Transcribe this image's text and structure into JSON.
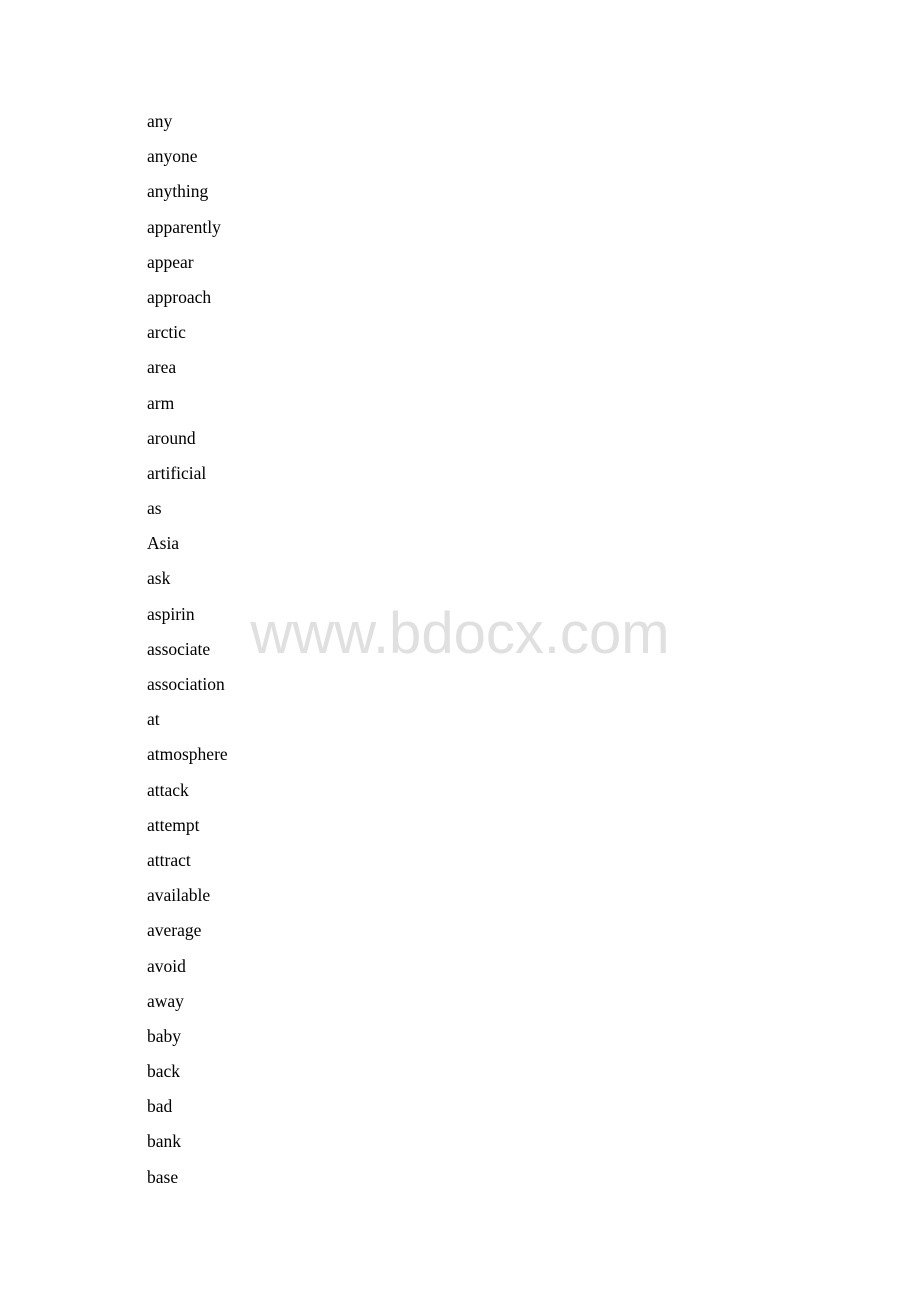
{
  "document": {
    "words": [
      "any",
      "anyone",
      "anything",
      "apparently",
      "appear",
      "approach",
      "arctic",
      "area",
      "arm",
      "around",
      "artificial",
      "as",
      "Asia",
      "ask",
      "aspirin",
      "associate",
      "association",
      "at",
      "atmosphere",
      "attack",
      "attempt",
      "attract",
      "available",
      "average",
      "avoid",
      "away",
      "baby",
      "back",
      "bad",
      "bank",
      "base"
    ]
  },
  "watermark": {
    "text": "www.bdocx.com",
    "color": "#e0e0e0"
  }
}
